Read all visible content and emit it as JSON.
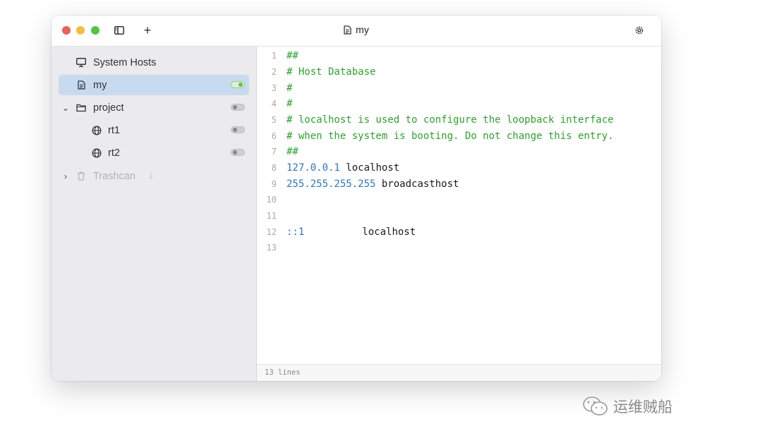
{
  "window": {
    "title": "my",
    "title_icon": "file-text-icon",
    "add_label": "+",
    "settings_icon": "gear-icon",
    "sidebar_toggle_icon": "sidebar-icon"
  },
  "sidebar": {
    "items": [
      {
        "label": "System Hosts",
        "icon": "monitor-icon"
      },
      {
        "label": "my",
        "icon": "file-text-icon",
        "toggle": "on",
        "selected": true
      },
      {
        "label": "project",
        "icon": "folder-icon",
        "toggle": "off",
        "expanded": true
      },
      {
        "label": "rt1",
        "icon": "globe-icon",
        "toggle": "off"
      },
      {
        "label": "rt2",
        "icon": "globe-icon",
        "toggle": "off"
      },
      {
        "label": "Trashcan",
        "icon": "trash-icon",
        "count": "1",
        "expanded": false
      }
    ]
  },
  "editor": {
    "lines": [
      {
        "n": "1",
        "comment": "##"
      },
      {
        "n": "2",
        "comment": "# Host Database"
      },
      {
        "n": "3",
        "comment": "#"
      },
      {
        "n": "4",
        "comment": "#"
      },
      {
        "n": "5",
        "comment": "# localhost is used to configure the loopback interface"
      },
      {
        "n": "6",
        "comment": "# when the system is booting. Do not change this entry."
      },
      {
        "n": "7",
        "comment": "##"
      },
      {
        "n": "8",
        "ip": "127.0.0.1",
        "host": "localhost"
      },
      {
        "n": "9",
        "ip": "255.255.255.255",
        "host": "broadcasthost"
      },
      {
        "n": "10"
      },
      {
        "n": "11"
      },
      {
        "n": "12",
        "ip": "::1",
        "host": "localhost"
      },
      {
        "n": "13"
      }
    ]
  },
  "statusbar": {
    "text": "13 lines"
  },
  "watermark": {
    "text": "运维贼船",
    "icon": "wechat-icon"
  },
  "colors": {
    "comment": "#2aa52a",
    "ip": "#2a76c6",
    "selected_row": "#c8daf0",
    "toggle_on": "#5ac24a"
  }
}
